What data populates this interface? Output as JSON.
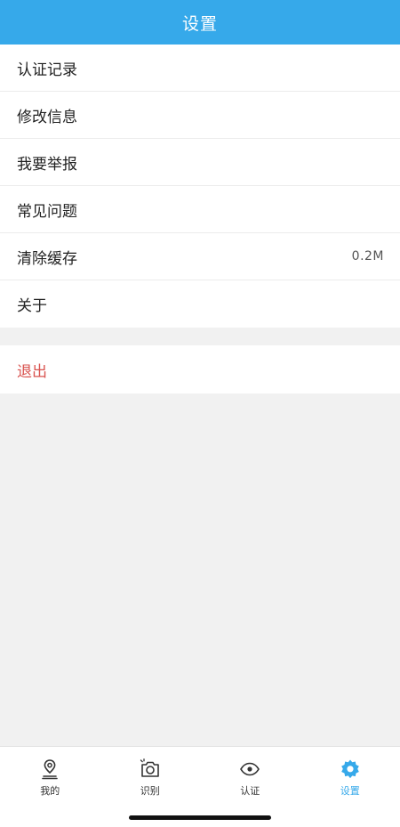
{
  "header": {
    "title": "设置"
  },
  "menu": {
    "items": [
      {
        "label": "认证记录"
      },
      {
        "label": "修改信息"
      },
      {
        "label": "我要举报"
      },
      {
        "label": "常见问题"
      },
      {
        "label": "清除缓存",
        "value": "0.2M"
      },
      {
        "label": "关于"
      }
    ]
  },
  "logout": {
    "label": "退出"
  },
  "tabbar": {
    "items": [
      {
        "label": "我的",
        "icon": "map-pin-icon"
      },
      {
        "label": "识别",
        "icon": "camera-icon"
      },
      {
        "label": "认证",
        "icon": "eye-icon"
      },
      {
        "label": "设置",
        "icon": "gear-icon",
        "active": true
      }
    ]
  },
  "colors": {
    "primary": "#36a9ea",
    "danger": "#d9534f",
    "background": "#f1f1f1"
  }
}
